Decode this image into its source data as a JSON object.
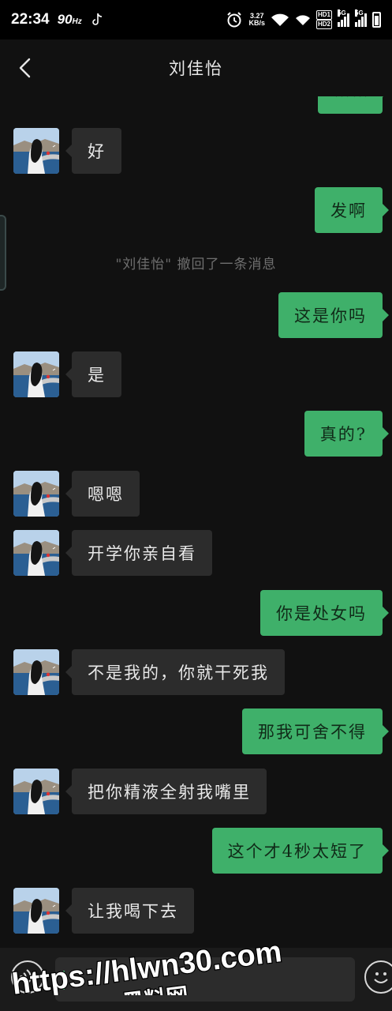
{
  "status_bar": {
    "time": "22:34",
    "refresh_rate": "90",
    "refresh_unit": "Hz",
    "net_speed_value": "3.27",
    "net_speed_unit": "KB/s",
    "hd_top": "HD1",
    "hd_bottom": "HD2",
    "signal_tag": "5G"
  },
  "nav": {
    "title": "刘佳怡"
  },
  "messages": [
    {
      "side": "out",
      "text": "……"
    },
    {
      "side": "in",
      "text": "好"
    },
    {
      "side": "out",
      "text": "发啊"
    },
    {
      "side": "system",
      "text": "\"刘佳怡\" 撤回了一条消息"
    },
    {
      "side": "out",
      "text": "这是你吗"
    },
    {
      "side": "in",
      "text": "是"
    },
    {
      "side": "out",
      "text": "真的?"
    },
    {
      "side": "in",
      "text": "嗯嗯"
    },
    {
      "side": "in",
      "text": "开学你亲自看"
    },
    {
      "side": "out",
      "text": "你是处女吗"
    },
    {
      "side": "in",
      "text": "不是我的，你就干死我"
    },
    {
      "side": "out",
      "text": "那我可舍不得"
    },
    {
      "side": "in",
      "text": "把你精液全射我嘴里"
    },
    {
      "side": "out",
      "text": "这个才4秒太短了"
    },
    {
      "side": "in",
      "text": "让我喝下去"
    }
  ],
  "input": {
    "placeholder": ""
  },
  "watermark": {
    "line1": "https://hlwn30.com",
    "line2": "黑料网"
  },
  "colors": {
    "outgoing_bubble": "#3fb06a",
    "incoming_bubble": "#2c2c2c",
    "background": "#111111"
  }
}
